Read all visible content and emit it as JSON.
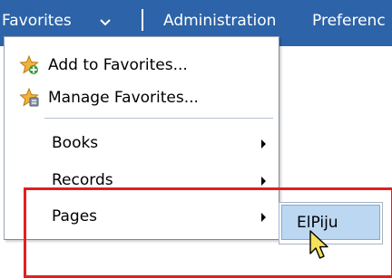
{
  "nav": {
    "favorites_label": "Favorites",
    "administration_label": "Administration",
    "preferences_label": "Preferenc"
  },
  "menu": {
    "add_label": "Add to Favorites...",
    "manage_label": "Manage Favorites...",
    "books_label": "Books",
    "records_label": "Records",
    "pages_label": "Pages"
  },
  "submenu": {
    "item_label": "ElPiju"
  },
  "icons": {
    "favorites_dropdown": "chevron-down-icon",
    "add_favorite": "star-add-icon",
    "manage_favorites": "star-manage-icon",
    "submenu_arrow": "caret-right-icon",
    "mouse": "cursor-arrow-icon"
  },
  "colors": {
    "nav_bar": "#2d63a8",
    "highlight": "#bcd7f2",
    "annotation_box": "#e11f1f",
    "star": "#f2b23a",
    "cursor": "#f4e15c"
  }
}
